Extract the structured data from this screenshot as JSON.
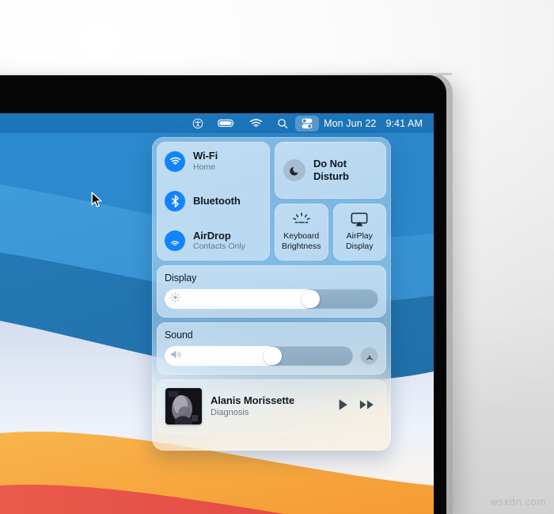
{
  "menubar": {
    "icons": [
      {
        "name": "accessibility-icon",
        "label": "Accessibility"
      },
      {
        "name": "battery-icon",
        "label": "Battery"
      },
      {
        "name": "wifi-icon",
        "label": "Wi-Fi"
      },
      {
        "name": "search-icon",
        "label": "Spotlight Search"
      },
      {
        "name": "control-center-icon",
        "label": "Control Center"
      }
    ],
    "date": "Mon Jun 22",
    "time": "9:41 AM"
  },
  "control_center": {
    "connectivity": [
      {
        "title": "Wi-Fi",
        "subtitle": "Home",
        "icon": "wifi-icon"
      },
      {
        "title": "Bluetooth",
        "subtitle": "",
        "icon": "bluetooth-icon"
      },
      {
        "title": "AirDrop",
        "subtitle": "Contacts Only",
        "icon": "airdrop-icon"
      }
    ],
    "do_not_disturb": {
      "line1": "Do Not",
      "line2": "Disturb",
      "icon": "moon-icon"
    },
    "tiles": [
      {
        "line1": "Keyboard",
        "line2": "Brightness",
        "icon": "keyboard-brightness-icon"
      },
      {
        "line1": "AirPlay",
        "line2": "Display",
        "icon": "airplay-display-icon"
      }
    ],
    "display": {
      "title": "Display",
      "value": 70,
      "icon": "brightness-icon"
    },
    "sound": {
      "title": "Sound",
      "value": 58,
      "icon": "speaker-icon",
      "airplay_icon": "airplay-audio-icon"
    },
    "music": {
      "artist": "Alanis Morissette",
      "track": "Diagnosis",
      "play_icon": "play-icon",
      "next_icon": "fast-forward-icon"
    }
  },
  "wallpaper": {
    "name": "macos-big-sur-wallpaper",
    "colors": [
      "#2f8ed4",
      "#2e8ccf",
      "#3d9ad8",
      "#2a7db8",
      "#1f6ca6",
      "#dfe6f5",
      "#f8b34a",
      "#f79f3b",
      "#e8554a"
    ]
  },
  "watermark": "wsxdn.com"
}
